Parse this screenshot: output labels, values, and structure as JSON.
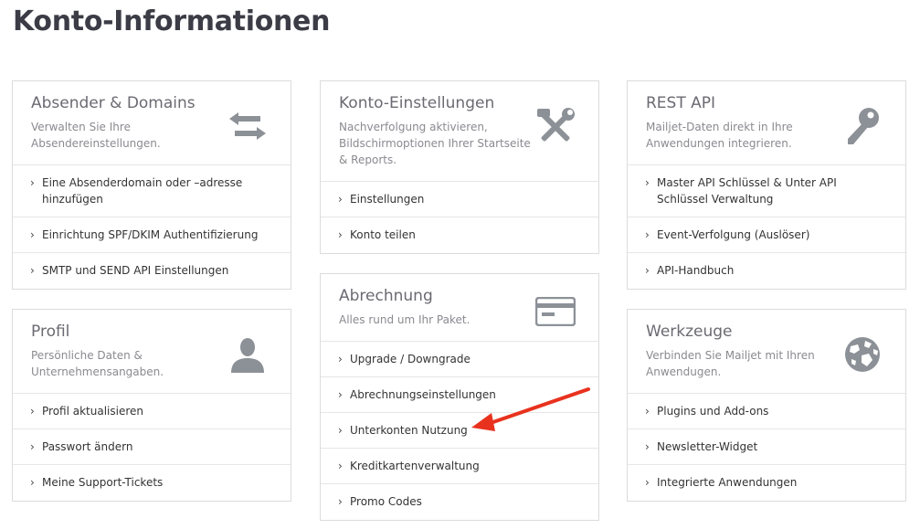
{
  "page": {
    "title": "Konto-Informationen"
  },
  "columns": [
    {
      "cards": [
        {
          "title": "Absender & Domains",
          "desc": "Verwalten Sie Ihre Absendereinstellungen.",
          "icon": "arrows-exchange-icon",
          "items": [
            "Eine Absenderdomain oder –adresse hinzufügen",
            "Einrichtung SPF/DKIM Authentifizierung",
            "SMTP und SEND API Einstellungen"
          ]
        },
        {
          "title": "Profil",
          "desc": "Persönliche Daten & Unternehmensangaben.",
          "icon": "user-icon",
          "items": [
            "Profil aktualisieren",
            "Passwort ändern",
            "Meine Support-Tickets"
          ]
        }
      ]
    },
    {
      "cards": [
        {
          "title": "Konto-Einstellungen",
          "desc": "Nachverfolgung aktivieren, Bildschirmoptionen Ihrer Startseite & Reports.",
          "icon": "tools-icon",
          "items": [
            "Einstellungen",
            "Konto teilen"
          ]
        },
        {
          "title": "Abrechnung",
          "desc": "Alles rund um Ihr Paket.",
          "icon": "credit-card-icon",
          "items": [
            "Upgrade / Downgrade",
            "Abrechnungseinstellungen",
            "Unterkonten Nutzung",
            "Kreditkartenverwaltung",
            "Promo Codes"
          ]
        }
      ]
    },
    {
      "cards": [
        {
          "title": "REST API",
          "desc": "Mailjet-Daten direkt in Ihre Anwendungen integrieren.",
          "icon": "key-icon",
          "items": [
            "Master API Schlüssel & Unter API Schlüssel Verwaltung",
            "Event-Verfolgung (Auslöser)",
            "API-Handbuch"
          ]
        },
        {
          "title": "Werkzeuge",
          "desc": "Verbinden Sie Mailjet mit Ihren Anwendugen.",
          "icon": "globe-icon",
          "items": [
            "Plugins und Add-ons",
            "Newsletter-Widget",
            "Integrierte Anwendungen"
          ]
        }
      ]
    }
  ],
  "colors": {
    "icon": "#8c9197",
    "arrow": "#e8321e",
    "border": "#dcdcdc"
  }
}
